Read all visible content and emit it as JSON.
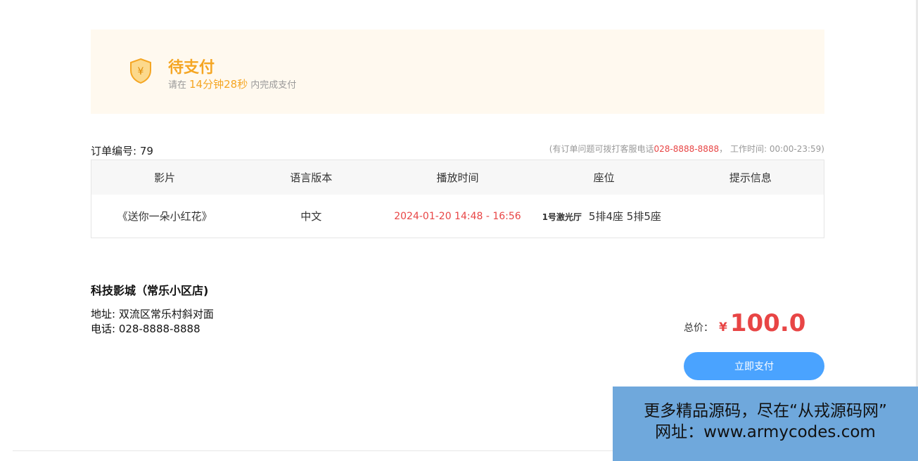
{
  "status": {
    "title": "待支付",
    "prefix": "请在",
    "countdown": "14分钟28秒",
    "suffix": "内完成支付"
  },
  "order": {
    "number_label": "订单编号: 79",
    "hotline_prefix": "(有订单问题可拨打客服电话",
    "hotline_phone": "028-8888-8888",
    "hotline_suffix": "，  工作时间: 00:00-23:59)"
  },
  "table": {
    "headers": [
      "影片",
      "语言版本",
      "播放时间",
      "座位",
      "提示信息"
    ],
    "row": {
      "movie": "《送你一朵小红花》",
      "language": "中文",
      "time": "2024-01-20 14:48 - 16:56",
      "hall": "1号激光厅",
      "seats": "5排4座 5排5座",
      "tip": ""
    }
  },
  "cinema": {
    "name": "科技影城（常乐小区店)",
    "address": "地址: 双流区常乐村斜对面",
    "phone": "电话: 028-8888-8888"
  },
  "payment": {
    "total_label": "总价：",
    "currency": "¥",
    "amount": "100.0",
    "pay_button": "立即支付"
  },
  "watermark": {
    "line1": "更多精品源码，尽在“从戎源码网”",
    "line2": "网址：www.armycodes.com"
  },
  "colors": {
    "accent_orange": "#f5a623",
    "price_red": "#e84545",
    "button_blue": "#4aa3ff",
    "banner_bg": "#fff9ef"
  }
}
